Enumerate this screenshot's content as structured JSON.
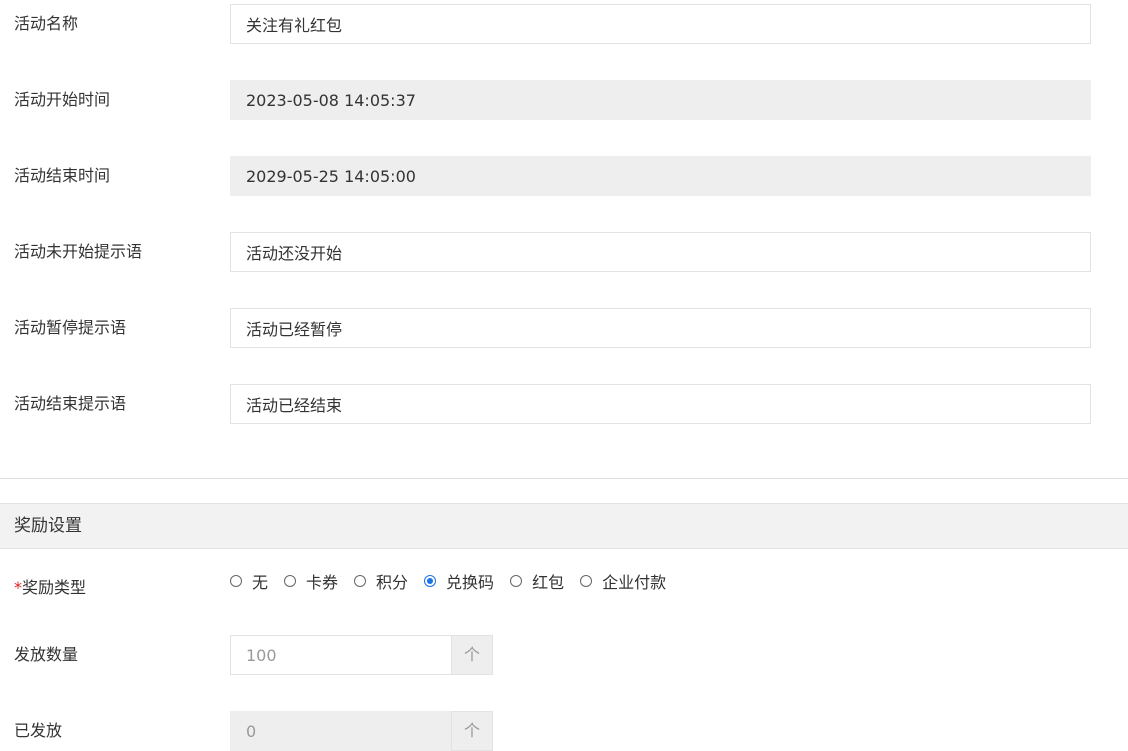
{
  "activity": {
    "fields": [
      {
        "label": "活动名称",
        "value": "关注有礼红包"
      },
      {
        "label": "活动开始时间",
        "value": "2023-05-08 14:05:37"
      },
      {
        "label": "活动结束时间",
        "value": "2029-05-25 14:05:00"
      },
      {
        "label": "活动未开始提示语",
        "value": "活动还没开始"
      },
      {
        "label": "活动暂停提示语",
        "value": "活动已经暂停"
      },
      {
        "label": "活动结束提示语",
        "value": "活动已经结束"
      }
    ]
  },
  "reward": {
    "section_title": "奖励设置",
    "type": {
      "required_mark": "*",
      "label": "奖励类型",
      "options": [
        "无",
        "卡券",
        "积分",
        "兑换码",
        "红包",
        "企业付款"
      ],
      "selected": "兑换码"
    },
    "quantity": {
      "label": "发放数量",
      "value": "100",
      "unit": "个"
    },
    "issued": {
      "label": "已发放",
      "value": "0",
      "unit": "个"
    }
  },
  "colors": {
    "accent": "#1a73e8",
    "required": "#e02020",
    "readonly_bg": "#eeeeee",
    "section_bg": "#f2f2f2"
  }
}
